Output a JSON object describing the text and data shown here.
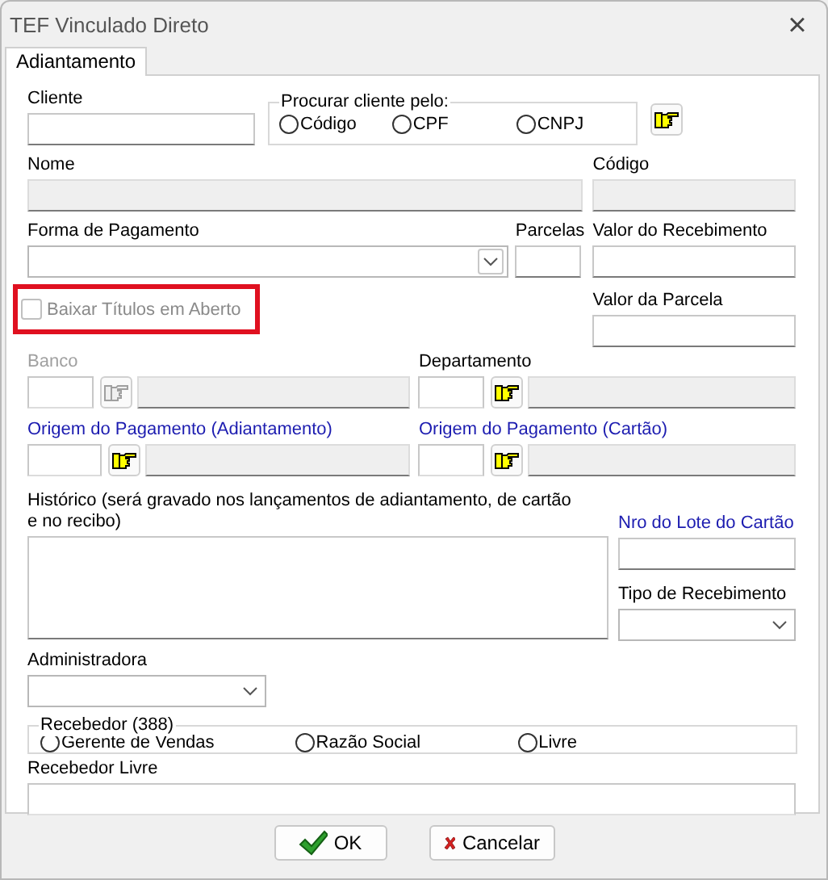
{
  "window": {
    "title": "TEF Vinculado Direto",
    "close": "×"
  },
  "tabs": [
    {
      "label": "Adiantamento",
      "selected": true
    }
  ],
  "cliente": {
    "label": "Cliente"
  },
  "procurar": {
    "legend": "Procurar cliente pelo:",
    "options": [
      {
        "label": "Código",
        "selected": false
      },
      {
        "label": "CPF",
        "selected": false
      },
      {
        "label": "CNPJ",
        "selected": false
      }
    ]
  },
  "nome": {
    "label": "Nome",
    "disabled": true
  },
  "codigo": {
    "label": "Código",
    "disabled": true
  },
  "forma_pagamento": {
    "label": "Forma de Pagamento"
  },
  "parcelas": {
    "label": "Parcelas"
  },
  "valor_recebimento": {
    "label": "Valor do Recebimento"
  },
  "baixar_titulos": {
    "label": "Baixar Títulos em Aberto",
    "checked": false,
    "disabled": true,
    "highlighted": true
  },
  "valor_parcela": {
    "label": "Valor da Parcela"
  },
  "lookups": [
    {
      "label": "Banco",
      "disabled": true,
      "linked": false
    },
    {
      "label": "Departamento",
      "disabled": false,
      "linked": false
    },
    {
      "label": "Origem do Pagamento (Adiantamento)",
      "disabled": false,
      "linked": true
    },
    {
      "label": "Origem do Pagamento (Cartão)",
      "disabled": false,
      "linked": true
    }
  ],
  "historico": {
    "label": "Histórico (será gravado nos lançamentos de adiantamento, de cartão e no recibo)"
  },
  "nro_lote": {
    "label": "Nro do Lote do Cartão",
    "linked": true
  },
  "tipo_recebimento": {
    "label": "Tipo de Recebimento"
  },
  "administradora": {
    "label": "Administradora"
  },
  "recebedor": {
    "legend": "Recebedor (388)",
    "options": [
      {
        "label": "Gerente de Vendas",
        "selected": false
      },
      {
        "label": "Razão Social",
        "selected": false
      },
      {
        "label": "Livre",
        "selected": false
      }
    ]
  },
  "recebedor_livre": {
    "label": "Recebedor Livre"
  },
  "buttons": [
    {
      "label": "OK",
      "kind": "ok"
    },
    {
      "label": "Cancelar",
      "kind": "cancel"
    }
  ]
}
